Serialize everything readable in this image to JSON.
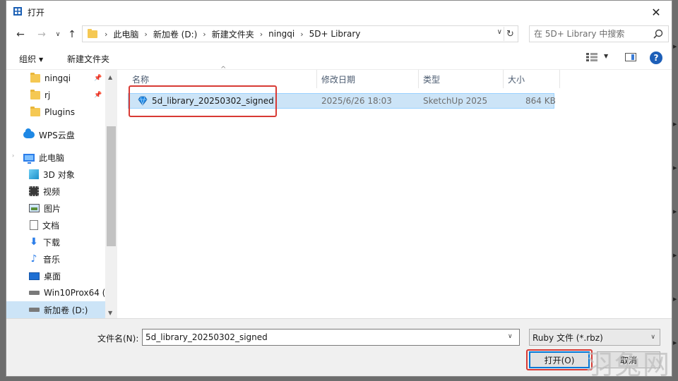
{
  "window": {
    "title": "打开",
    "close_glyph": "✕"
  },
  "address_bar": {
    "back_glyph": "←",
    "forward_glyph": "→",
    "dropdown_glyph": "∨",
    "up_glyph": "↑",
    "breadcrumbs": [
      "此电脑",
      "新加卷 (D:)",
      "新建文件夹",
      "ningqi",
      "5D+ Library"
    ],
    "separator": "›",
    "history_glyph": "∨",
    "refresh_glyph": "↻"
  },
  "search": {
    "placeholder": "在 5D+ Library 中搜索"
  },
  "toolbar": {
    "organize_label": "组织",
    "organize_caret": "▼",
    "new_folder_label": "新建文件夹",
    "view_caret": "▼",
    "help_glyph": "?"
  },
  "nav_pane": {
    "items": [
      {
        "label": "ningqi",
        "icon": "folder-icon",
        "pinned": true
      },
      {
        "label": "rj",
        "icon": "folder-icon",
        "pinned": true
      },
      {
        "label": "Plugins",
        "icon": "folder-icon",
        "pinned": false
      },
      {
        "label": "WPS云盘",
        "icon": "cloud-icon",
        "pinned": false
      },
      {
        "label": "此电脑",
        "icon": "computer-icon",
        "pinned": false
      },
      {
        "label": "3D 对象",
        "icon": "3d-objects-icon",
        "pinned": false
      },
      {
        "label": "视频",
        "icon": "video-icon",
        "pinned": false
      },
      {
        "label": "图片",
        "icon": "picture-icon",
        "pinned": false
      },
      {
        "label": "文档",
        "icon": "document-icon",
        "pinned": false
      },
      {
        "label": "下载",
        "icon": "download-icon",
        "pinned": false
      },
      {
        "label": "音乐",
        "icon": "music-icon",
        "pinned": false
      },
      {
        "label": "桌面",
        "icon": "desktop-icon",
        "pinned": false
      },
      {
        "label": "Win10Prox64 (",
        "icon": "drive-icon",
        "pinned": false
      },
      {
        "label": "新加卷 (D:)",
        "icon": "drive-icon",
        "pinned": false
      }
    ],
    "pin_glyph": "📌",
    "expander_glyph": "›"
  },
  "file_list": {
    "sort_glyph": "^",
    "columns": [
      "名称",
      "修改日期",
      "类型",
      "大小"
    ],
    "rows": [
      {
        "name": "5d_library_20250302_signed",
        "modified": "2025/6/26 18:03",
        "type": "SketchUp 2025",
        "size": "864 KB"
      }
    ]
  },
  "bottom": {
    "filename_label": "文件名(N):",
    "filename_value": "5d_library_20250302_signed",
    "filetype": "Ruby 文件 (*.rbz)",
    "caret": "∨",
    "open_label": "打开(O)",
    "cancel_label": "取消"
  },
  "watermark": "羽兔网",
  "colors": {
    "accent": "#0078d7",
    "selection": "#cce4f7",
    "highlight_red": "#d83a34"
  }
}
